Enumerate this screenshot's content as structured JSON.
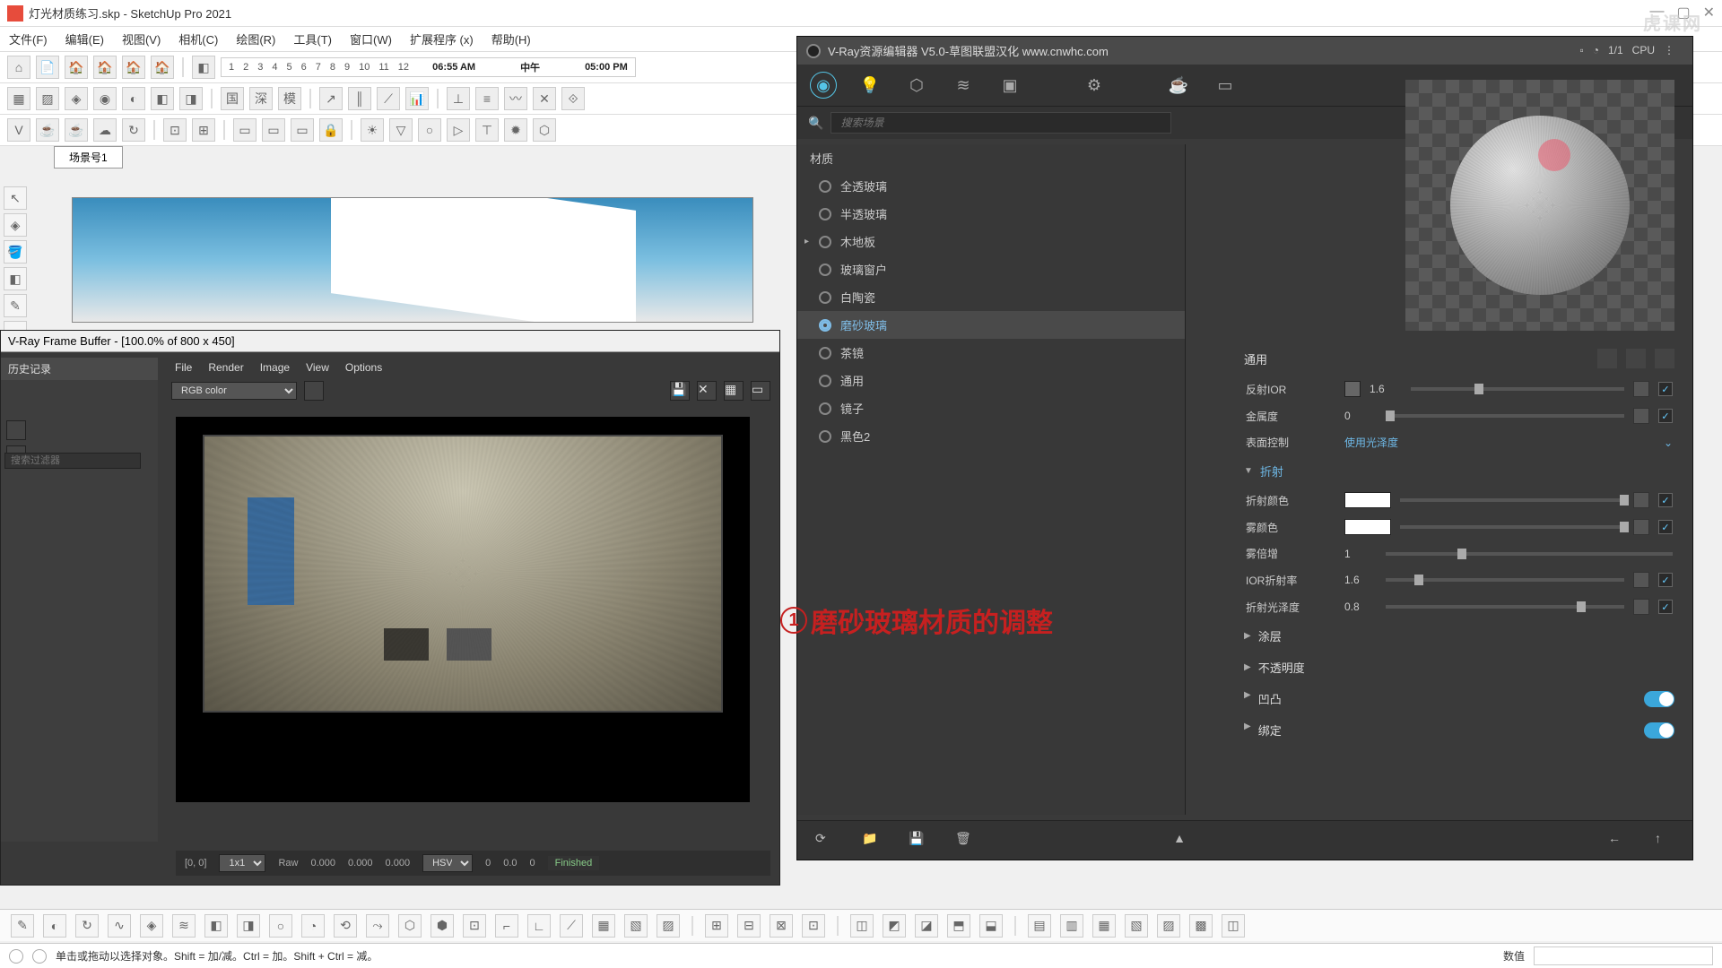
{
  "app": {
    "title": "灯光材质练习.skp - SketchUp Pro 2021"
  },
  "menubar": [
    "文件(F)",
    "编辑(E)",
    "视图(V)",
    "相机(C)",
    "绘图(R)",
    "工具(T)",
    "窗口(W)",
    "扩展程序 (x)",
    "帮助(H)"
  ],
  "timeline": {
    "nums": [
      "1",
      "2",
      "3",
      "4",
      "5",
      "6",
      "7",
      "8",
      "9",
      "10",
      "11",
      "12"
    ],
    "t1": "06:55 AM",
    "mid": "中午",
    "t2": "05:00 PM"
  },
  "scene_tab": "场景号1",
  "vfb": {
    "title": "V-Ray Frame Buffer - [100.0% of 800 x 450]",
    "history": "历史记录",
    "menu": [
      "File",
      "Render",
      "Image",
      "View",
      "Options"
    ],
    "channel": "RGB color",
    "search_ph": "搜索过滤器",
    "coords": "[0, 0]",
    "grid": "1x1",
    "raw": "Raw",
    "v0": "0.000",
    "v1": "0.000",
    "v2": "0.000",
    "mode": "HSV",
    "h": "0",
    "s": "0.0",
    "v": "0",
    "state": "Finished"
  },
  "vray": {
    "title": "V-Ray资源编辑器 V5.0-草图联盟汉化 www.cnwhc.com",
    "search_ph": "搜索场景",
    "mat_head": "材质",
    "materials": [
      {
        "name": "全透玻璃",
        "sel": false
      },
      {
        "name": "半透玻璃",
        "sel": false
      },
      {
        "name": "木地板",
        "sel": false,
        "expand": true
      },
      {
        "name": "玻璃窗户",
        "sel": false
      },
      {
        "name": "白陶瓷",
        "sel": false
      },
      {
        "name": "磨砂玻璃",
        "sel": true
      },
      {
        "name": "茶镜",
        "sel": false
      },
      {
        "name": "通用",
        "sel": false
      },
      {
        "name": "镜子",
        "sel": false
      },
      {
        "name": "黑色2",
        "sel": false
      }
    ],
    "panel_title": "通用",
    "reflect_ior_lbl": "反射IOR",
    "reflect_ior": "1.6",
    "metal_lbl": "金属度",
    "metal": "0",
    "surface_lbl": "表面控制",
    "surface_val": "使用光泽度",
    "refraction_h": "折射",
    "refr_color_lbl": "折射颜色",
    "fog_color_lbl": "雾颜色",
    "fog_mult_lbl": "雾倍增",
    "fog_mult": "1",
    "ior_lbl": "IOR折射率",
    "ior": "1.6",
    "gloss_lbl": "折射光泽度",
    "gloss": "0.8",
    "coat_h": "涂层",
    "opacity_h": "不透明度",
    "bump_h": "凹凸",
    "bind_h": "绑定",
    "render_badge": "1/1",
    "render_mode": "CPU"
  },
  "annotation": {
    "num": "1",
    "text": "磨砂玻璃材质的调整"
  },
  "statusbar": {
    "hint": "单击或拖动以选择对象。Shift = 加/减。Ctrl = 加。Shift + Ctrl = 减。",
    "rlabel": "数值"
  },
  "watermark": "虎课网"
}
